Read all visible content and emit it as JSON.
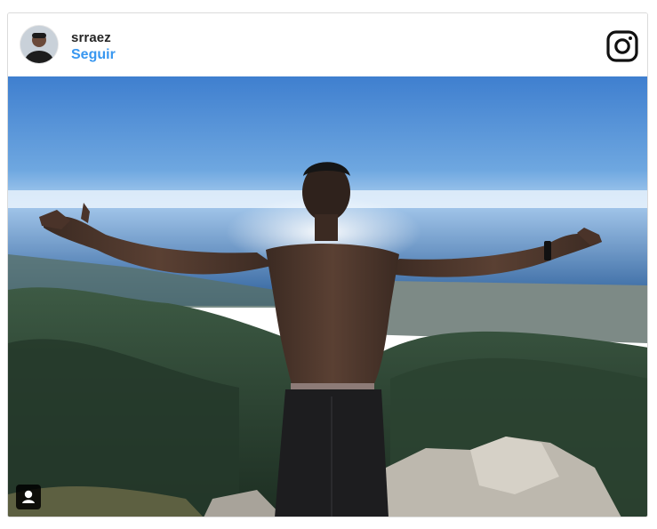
{
  "post": {
    "username": "srraez",
    "follow_label": "Seguir"
  },
  "icons": {
    "avatar": "avatar",
    "brand": "instagram-icon",
    "user_tag": "user-tag-icon"
  },
  "colors": {
    "follow_blue": "#3897f0",
    "username": "#262626",
    "border": "#dbdbdb"
  }
}
